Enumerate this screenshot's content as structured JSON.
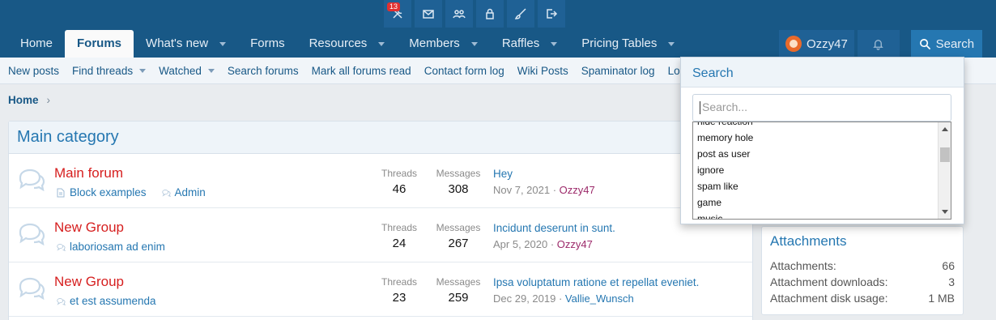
{
  "admin_bar": {
    "badge_count": "13",
    "icons": [
      "tools-icon",
      "envelope-icon",
      "users-cog-icon",
      "lock-icon",
      "brush-icon",
      "logout-icon"
    ]
  },
  "nav": {
    "tabs": [
      {
        "label": "Home",
        "active": false,
        "has_menu": false
      },
      {
        "label": "Forums",
        "active": true,
        "has_menu": false
      },
      {
        "label": "What's new",
        "active": false,
        "has_menu": true
      },
      {
        "label": "Forms",
        "active": false,
        "has_menu": false
      },
      {
        "label": "Resources",
        "active": false,
        "has_menu": true
      },
      {
        "label": "Members",
        "active": false,
        "has_menu": true
      },
      {
        "label": "Raffles",
        "active": false,
        "has_menu": true
      },
      {
        "label": "Pricing Tables",
        "active": false,
        "has_menu": true
      }
    ],
    "username": "Ozzy47",
    "search_label": "Search"
  },
  "subnav": {
    "items": [
      {
        "label": "New posts",
        "has_menu": false
      },
      {
        "label": "Find threads",
        "has_menu": true
      },
      {
        "label": "Watched",
        "has_menu": true
      },
      {
        "label": "Search forums",
        "has_menu": false
      },
      {
        "label": "Mark all forums read",
        "has_menu": false
      },
      {
        "label": "Contact form log",
        "has_menu": false
      },
      {
        "label": "Wiki Posts",
        "has_menu": false
      },
      {
        "label": "Spaminator log",
        "has_menu": false
      },
      {
        "label": "Login",
        "has_menu": false
      }
    ]
  },
  "breadcrumb": {
    "home": "Home"
  },
  "category": {
    "title": "Main category",
    "threads_label": "Threads",
    "messages_label": "Messages",
    "forums": [
      {
        "title": "Main forum",
        "sub1": "Block examples",
        "sub2": "Admin",
        "threads": "46",
        "messages": "308",
        "latest_title": "Hey",
        "latest_date": "Nov 7, 2021",
        "latest_user": "Ozzy47",
        "user_style": "u1"
      },
      {
        "title": "New Group",
        "sub1": "laboriosam ad enim",
        "sub2": "",
        "threads": "24",
        "messages": "267",
        "latest_title": "Incidunt deserunt in sunt.",
        "latest_date": "Apr 5, 2020",
        "latest_user": "Ozzy47",
        "user_style": "u1"
      },
      {
        "title": "New Group",
        "sub1": "et est assumenda",
        "sub2": "",
        "threads": "23",
        "messages": "259",
        "latest_title": "Ipsa voluptatum ratione et repellat eveniet.",
        "latest_date": "Dec 29, 2019",
        "latest_user": "Vallie_Wunsch",
        "user_style": "u2"
      }
    ]
  },
  "sidebar": {
    "attachments_title": "Attachments",
    "lines": [
      {
        "label": "Attachments:",
        "value": "66"
      },
      {
        "label": "Attachment downloads:",
        "value": "3"
      },
      {
        "label": "Attachment disk usage:",
        "value": "1 MB"
      }
    ]
  },
  "search_popup": {
    "title": "Search",
    "placeholder": "Search...",
    "suggestions": [
      "hide reaction",
      "memory hole",
      "post as user",
      "ignore",
      "spam like",
      "game",
      "music"
    ]
  }
}
